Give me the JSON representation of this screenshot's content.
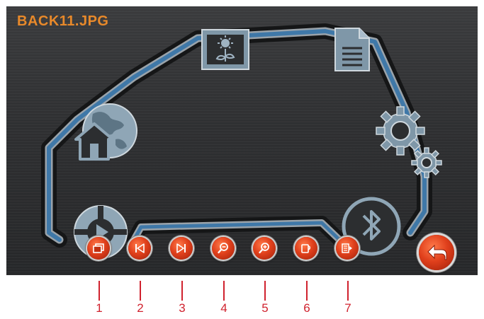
{
  "screen": {
    "title": "BACK11.JPG"
  },
  "menu_icons": [
    {
      "name": "picture-frame-icon"
    },
    {
      "name": "document-icon"
    },
    {
      "name": "settings-gears-icon"
    },
    {
      "name": "bluetooth-icon"
    },
    {
      "name": "media-play-icon"
    },
    {
      "name": "home-globe-icon"
    }
  ],
  "toolbar": {
    "buttons": [
      {
        "icon": "slideshow-icon"
      },
      {
        "icon": "previous-icon"
      },
      {
        "icon": "next-icon"
      },
      {
        "icon": "zoom-out-icon"
      },
      {
        "icon": "zoom-in-icon"
      },
      {
        "icon": "rotate-icon"
      },
      {
        "icon": "file-list-icon"
      }
    ],
    "back": {
      "icon": "back-arrow-icon"
    }
  },
  "callouts": [
    "1",
    "2",
    "3",
    "4",
    "5",
    "6",
    "7"
  ],
  "colors": {
    "accent": "#e8892a",
    "button_red": "#e0401c",
    "track_blue": "#3f78a8",
    "icon_gray": "#7f97a8",
    "callout_red": "#d0222e"
  }
}
